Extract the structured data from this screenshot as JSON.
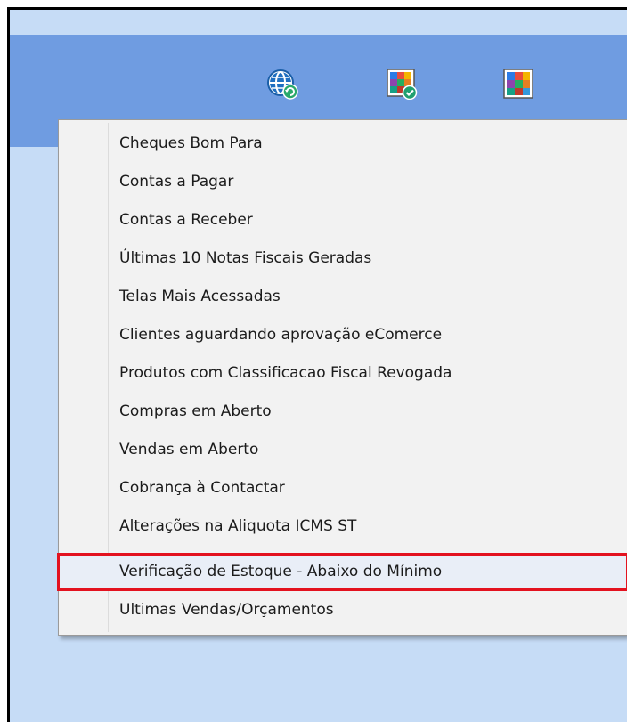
{
  "toolbar": {
    "icons": [
      "globe-refresh-icon",
      "color-grid-check-icon",
      "color-grid-icon"
    ]
  },
  "menu": {
    "items": [
      {
        "label": "Cheques Bom Para"
      },
      {
        "label": "Contas a Pagar"
      },
      {
        "label": "Contas a Receber"
      },
      {
        "label": "Últimas 10 Notas Fiscais Geradas"
      },
      {
        "label": "Telas Mais Acessadas"
      },
      {
        "label": "Clientes aguardando aprovação eComerce"
      },
      {
        "label": "Produtos com Classificacao Fiscal Revogada"
      },
      {
        "label": "Compras em Aberto"
      },
      {
        "label": "Vendas em Aberto"
      },
      {
        "label": "Cobrança à Contactar"
      },
      {
        "label": "Alterações na Aliquota ICMS ST"
      },
      {
        "label": "Verificação de Estoque - Abaixo do Mínimo",
        "highlighted": true
      },
      {
        "label": "Ultimas Vendas/Orçamentos"
      }
    ]
  },
  "colors": {
    "toolbar": "#6f9ce1",
    "background": "#c6dcf6",
    "menu": "#f2f2f2",
    "highlight_border": "#e3121f"
  }
}
